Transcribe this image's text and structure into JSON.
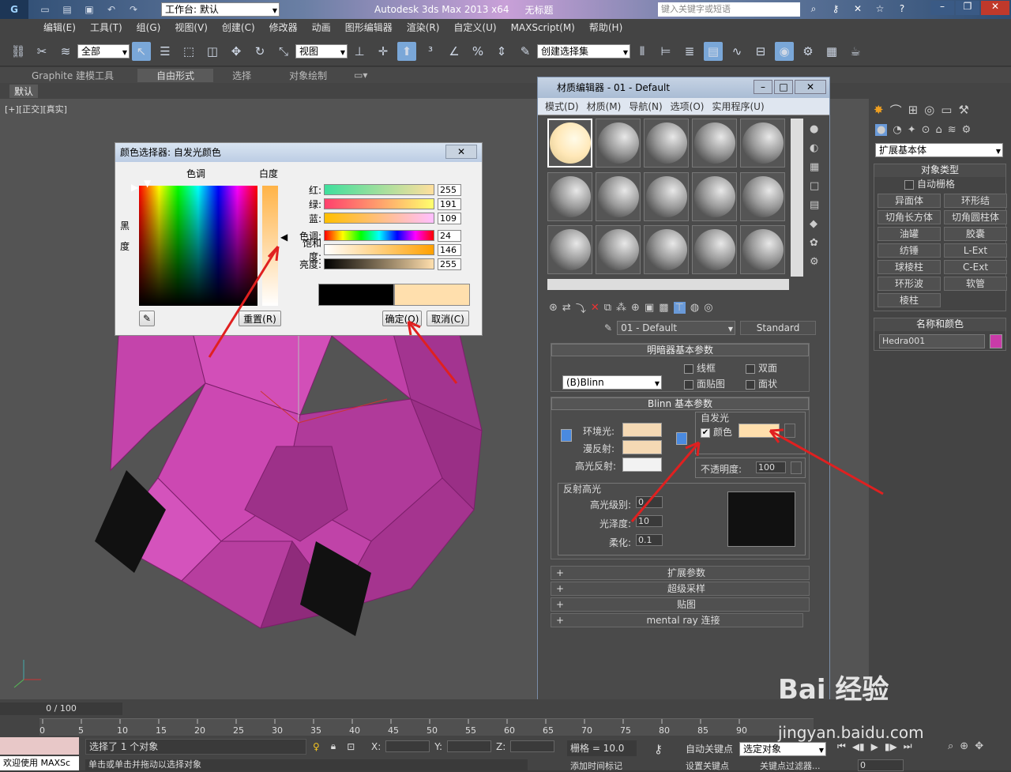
{
  "app": {
    "title": "Autodesk 3ds Max  2013 x64",
    "file": "无标题",
    "workspace": "工作台: 默认",
    "search_placeholder": "键入关键字或短语"
  },
  "menu": [
    "编辑(E)",
    "工具(T)",
    "组(G)",
    "视图(V)",
    "创建(C)",
    "修改器",
    "动画",
    "图形编辑器",
    "渲染(R)",
    "自定义(U)",
    "MAXScript(M)",
    "帮助(H)"
  ],
  "toolbar": {
    "filter": "全部",
    "refcoord": "视图",
    "selset": "创建选择集"
  },
  "ribbon": {
    "tabs": [
      "Graphite 建模工具",
      "自由形式",
      "选择",
      "对象绘制"
    ],
    "sub": "默认"
  },
  "viewport": {
    "label": "[+][正交][真实]"
  },
  "colorpicker": {
    "title": "颜色选择器: 自发光颜色",
    "hue_label": "色调",
    "white_label": "白度",
    "black_label": "黑",
    "black_label2": "度",
    "rows": [
      {
        "label": "红:",
        "value": "255"
      },
      {
        "label": "绿:",
        "value": "191"
      },
      {
        "label": "蓝:",
        "value": "109"
      },
      {
        "label": "色调:",
        "value": "24"
      },
      {
        "label": "饱和度:",
        "value": "146"
      },
      {
        "label": "亮度:",
        "value": "255"
      }
    ],
    "reset": "重置(R)",
    "ok": "确定(O)",
    "cancel": "取消(C)",
    "new_color": "#ffdfad"
  },
  "mated": {
    "title": "材质编辑器 - 01 - Default",
    "menu": [
      "模式(D)",
      "材质(M)",
      "导航(N)",
      "选项(O)",
      "实用程序(U)"
    ],
    "matname": "01 - Default",
    "mattype": "Standard",
    "shader_rollout": "明暗器基本参数",
    "shader": "(B)Blinn",
    "wire": "线框",
    "twosided": "双面",
    "facemap": "面贴图",
    "faceted": "面状",
    "blinn_rollout": "Blinn 基本参数",
    "self_illum": "自发光",
    "color_label": "颜色",
    "ambient": "环境光:",
    "diffuse": "漫反射:",
    "specular": "高光反射:",
    "opacity_label": "不透明度:",
    "opacity": "100",
    "spec_highlights": "反射高光",
    "spec_level_label": "高光级别:",
    "spec_level": "0",
    "gloss_label": "光泽度:",
    "gloss": "10",
    "soften_label": "柔化:",
    "soften": "0.1",
    "collapsed": [
      "扩展参数",
      "超级采样",
      "贴图",
      "mental ray 连接"
    ]
  },
  "cmd": {
    "dropdown": "扩展基本体",
    "objtype": "对象类型",
    "autogrid": "自动栅格",
    "buttons": [
      "异面体",
      "环形结",
      "切角长方体",
      "切角圆柱体",
      "油罐",
      "胶囊",
      "纺锤",
      "L-Ext",
      "球棱柱",
      "C-Ext",
      "环形波",
      "软管",
      "棱柱"
    ],
    "namecolor": "名称和颜色",
    "objname": "Hedra001",
    "objcolor": "#c93ba8"
  },
  "status": {
    "timeline": "0 / 100",
    "ticks": [
      "0",
      "5",
      "10",
      "15",
      "20",
      "25",
      "30",
      "35",
      "40",
      "45",
      "50",
      "55",
      "60",
      "65",
      "70",
      "75",
      "80",
      "85",
      "90"
    ],
    "selected": "选择了 1 个对象",
    "hint": "单击或单击并拖动以选择对象",
    "maxscript": "欢迎使用 MAXSc",
    "grid": "栅格 = 10.0",
    "autokey": "自动关键点",
    "setkey": "设置关键点",
    "selobj": "选定对象",
    "keyfilter": "关键点过滤器...",
    "addtime": "添加时间标记",
    "frame": "0",
    "x": "X:",
    "y": "Y:",
    "z": "Z:"
  },
  "watermark": {
    "brand": "Bai 经验",
    "url": "jingyan.baidu.com"
  }
}
